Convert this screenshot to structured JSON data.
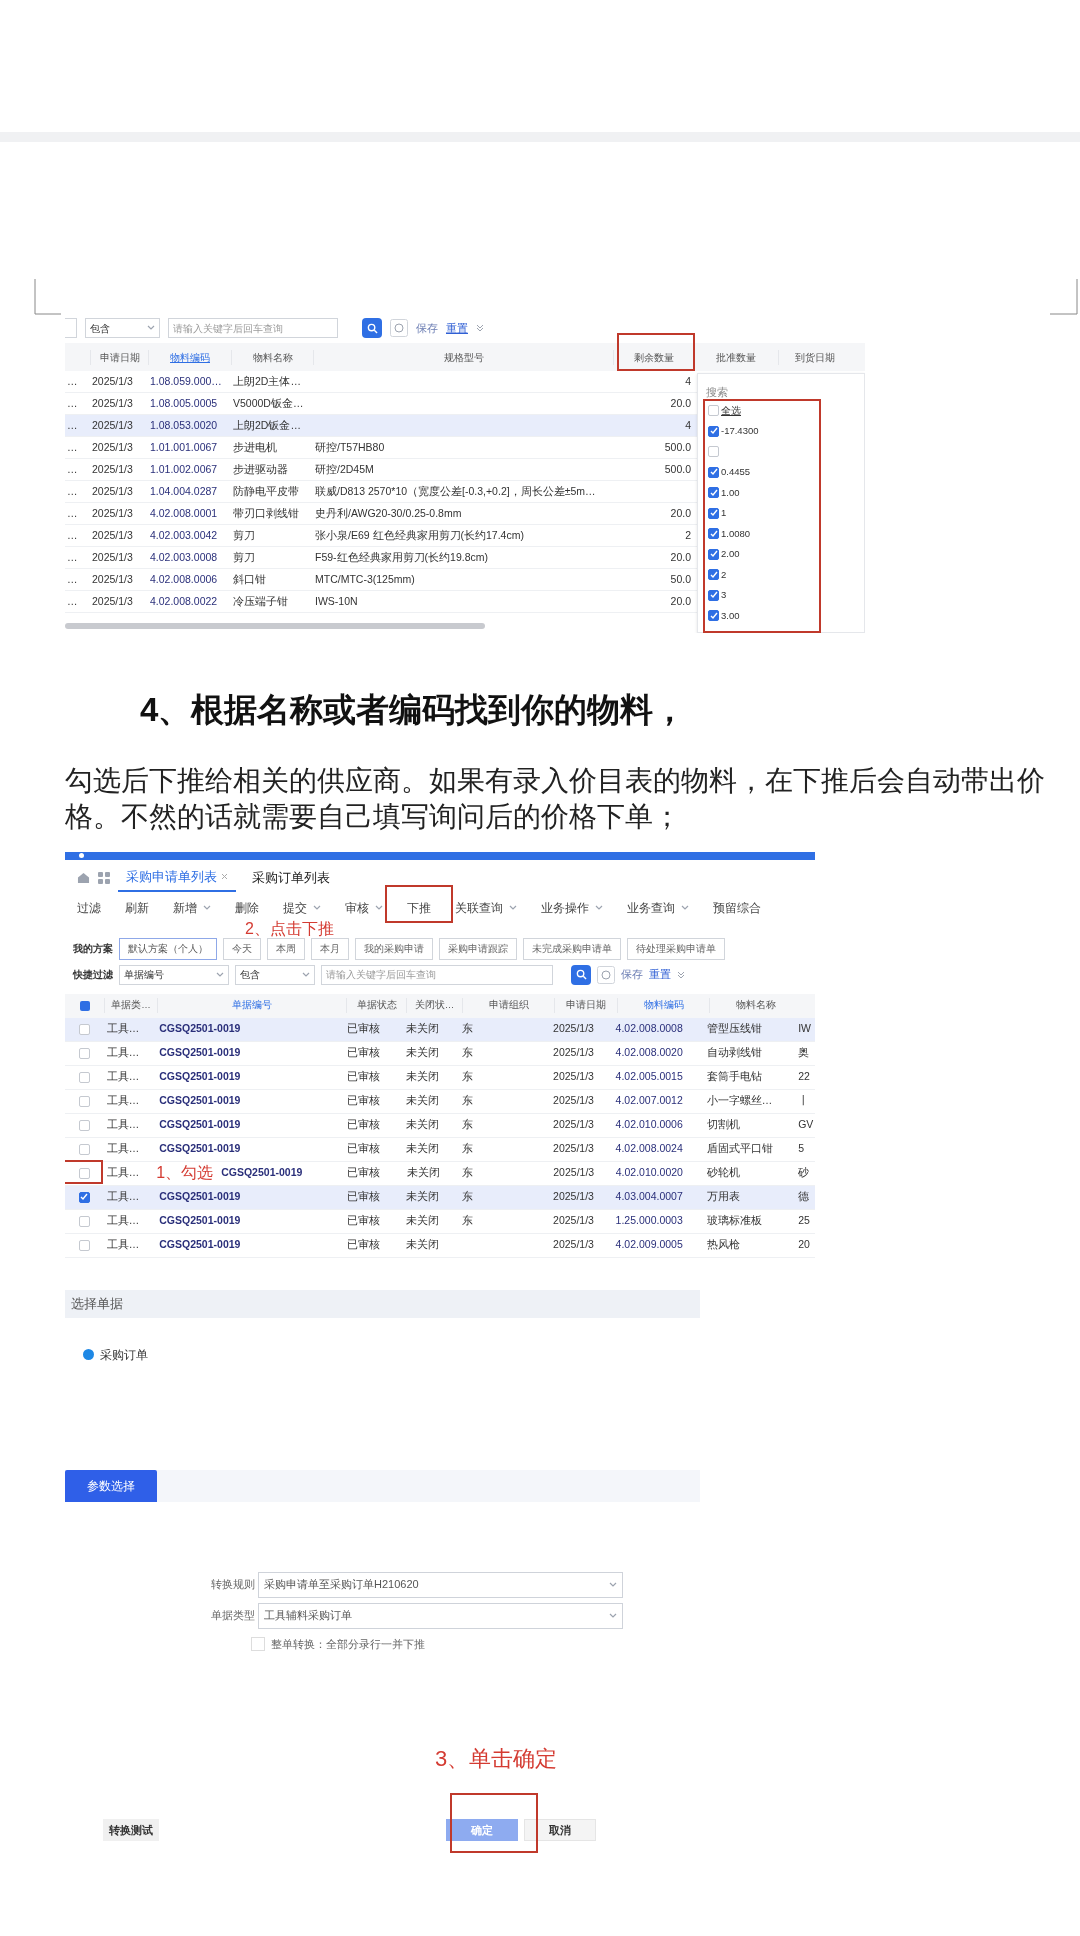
{
  "shot1": {
    "filter_select": "包含",
    "search_placeholder": "请输入关键字后回车查询",
    "save": "保存",
    "reset": "重置",
    "columns": [
      {
        "label": "申请日期",
        "link": false
      },
      {
        "label": "物料编码",
        "link": true
      },
      {
        "label": "物料名称",
        "link": false
      },
      {
        "label": "规格型号",
        "link": false
      },
      {
        "label": "剩余数量",
        "link": false
      },
      {
        "label": "批准数量",
        "link": false
      },
      {
        "label": "到货日期",
        "link": false
      }
    ],
    "rows": [
      {
        "selected": false,
        "lead": "…",
        "cells": [
          "2025/1/3",
          "1.08.059.000…",
          "上朗2D主体…",
          "",
          "4"
        ]
      },
      {
        "selected": false,
        "lead": "…",
        "cells": [
          "2025/1/3",
          "1.08.005.0005",
          "V5000D钣金…",
          "",
          "20.0"
        ]
      },
      {
        "selected": true,
        "lead": "…",
        "cells": [
          "2025/1/3",
          "1.08.053.0020",
          "上朗2D钣金…",
          "",
          "4"
        ]
      },
      {
        "selected": false,
        "lead": "…",
        "cells": [
          "2025/1/3",
          "1.01.001.0067",
          "步进电机",
          "研控/T57HB80",
          "500.0"
        ]
      },
      {
        "selected": false,
        "lead": "…",
        "cells": [
          "2025/1/3",
          "1.01.002.0067",
          "步进驱动器",
          "研控/2D45M",
          "500.0"
        ]
      },
      {
        "selected": false,
        "lead": "…",
        "cells": [
          "2025/1/3",
          "1.04.004.0287",
          "防静电平皮带",
          "联威/D813 2570*10（宽度公差[-0.3,+0.2]，周长公差±5m…",
          ""
        ]
      },
      {
        "selected": false,
        "lead": "…",
        "cells": [
          "2025/1/3",
          "4.02.008.0001",
          "带刃口剥线钳",
          "史丹利/AWG20-30/0.25-0.8mm",
          "20.0"
        ]
      },
      {
        "selected": false,
        "lead": "…",
        "cells": [
          "2025/1/3",
          "4.02.003.0042",
          "剪刀",
          "张小泉/E69 红色经典家用剪刀(长约17.4cm)",
          "2"
        ]
      },
      {
        "selected": false,
        "lead": "…",
        "cells": [
          "2025/1/3",
          "4.02.003.0008",
          "剪刀",
          "F59-红色经典家用剪刀(长约19.8cm)",
          "20.0"
        ]
      },
      {
        "selected": false,
        "lead": "…",
        "cells": [
          "2025/1/3",
          "4.02.008.0006",
          "斜口钳",
          "MTC/MTC-3(125mm)",
          "50.0"
        ]
      },
      {
        "selected": false,
        "lead": "…",
        "cells": [
          "2025/1/3",
          "4.02.008.0022",
          "冷压端子钳",
          "IWS-10N",
          "20.0"
        ]
      }
    ],
    "filter_popup": {
      "title": "搜索",
      "items": [
        {
          "label": "全选",
          "checked": false
        },
        {
          "label": "-17.4300",
          "checked": true
        },
        {
          "checked": false
        },
        {
          "label": "0.4455",
          "checked": true
        },
        {
          "label": "1.00",
          "checked": true
        },
        {
          "label": "1",
          "checked": true
        },
        {
          "label": "1.0080",
          "checked": true
        },
        {
          "label": "2.00",
          "checked": true
        },
        {
          "label": "2",
          "checked": true
        },
        {
          "label": "3",
          "checked": true
        },
        {
          "label": "3.00",
          "checked": true
        }
      ]
    }
  },
  "heading": "4、根据名称或者编码找到你的物料，",
  "paragraph": "勾选后下推给相关的供应商。如果有录入价目表的物料，在下推后会自动带出价格。不然的话就需要自己填写询问后的价格下单；",
  "shot2": {
    "tabs": [
      {
        "label": "采购申请单列表",
        "selected": true,
        "closable": true
      },
      {
        "label": "采购订单列表",
        "selected": false,
        "closable": false
      }
    ],
    "toolbar": [
      {
        "label": "过滤",
        "dropdown": false,
        "highlighted": false
      },
      {
        "label": "刷新",
        "dropdown": false,
        "highlighted": false
      },
      {
        "label": "新增",
        "dropdown": true,
        "highlighted": false
      },
      {
        "label": "删除",
        "dropdown": false,
        "highlighted": false
      },
      {
        "label": "提交",
        "dropdown": true,
        "highlighted": false
      },
      {
        "label": "审核",
        "dropdown": true,
        "highlighted": false
      },
      {
        "label": "下推",
        "dropdown": false,
        "highlighted": true
      },
      {
        "label": "关联查询",
        "dropdown": true,
        "highlighted": false
      },
      {
        "label": "业务操作",
        "dropdown": true,
        "highlighted": false
      },
      {
        "label": "业务查询",
        "dropdown": true,
        "highlighted": false
      },
      {
        "label": "预留综合",
        "dropdown": false,
        "highlighted": false
      }
    ],
    "scheme_label": "我的方案",
    "schemes": [
      {
        "label": "默认方案（个人）",
        "selected": true
      },
      {
        "label": "今天",
        "selected": false
      },
      {
        "label": "本周",
        "selected": false
      },
      {
        "label": "本月",
        "selected": false
      },
      {
        "label": "我的采购申请",
        "selected": false
      },
      {
        "label": "采购申请跟踪",
        "selected": false
      },
      {
        "label": "未完成采购申请单",
        "selected": false
      },
      {
        "label": "待处理采购申请单",
        "selected": false
      }
    ],
    "select_all_checked": true,
    "quick_filter_label": "快捷过滤",
    "field_select": "单据编号",
    "op_select": "包含",
    "search_placeholder": "请输入关键字后回车查询",
    "save": "保存",
    "reset": "重置",
    "columns": [
      {
        "label": "单据类…",
        "link": false
      },
      {
        "label": "单据编号",
        "link": true
      },
      {
        "label": "单据状态",
        "link": false
      },
      {
        "label": "关闭状…",
        "link": false
      },
      {
        "label": "申请组织",
        "link": false
      },
      {
        "label": "申请日期",
        "link": false
      },
      {
        "label": "物料编码",
        "link": true
      },
      {
        "label": "物料名称",
        "link": false
      }
    ],
    "rows": [
      {
        "checked": false,
        "selected": true,
        "cells": [
          "工具…",
          "CGSQ2501-0019",
          "已审核",
          "未关闭",
          "东",
          "2025/1/3",
          "4.02.008.0008",
          "管型压线钳",
          "IW"
        ]
      },
      {
        "checked": false,
        "selected": false,
        "cells": [
          "工具…",
          "CGSQ2501-0019",
          "已审核",
          "未关闭",
          "东",
          "2025/1/3",
          "4.02.008.0020",
          "自动剥线钳",
          "奥"
        ]
      },
      {
        "checked": false,
        "selected": false,
        "cells": [
          "工具…",
          "CGSQ2501-0019",
          "已审核",
          "未关闭",
          "东",
          "2025/1/3",
          "4.02.005.0015",
          "套筒手电钻",
          "22"
        ]
      },
      {
        "checked": false,
        "selected": false,
        "cells": [
          "工具…",
          "CGSQ2501-0019",
          "已审核",
          "未关闭",
          "东",
          "2025/1/3",
          "4.02.007.0012",
          "小一字螺丝…",
          "丨"
        ]
      },
      {
        "checked": false,
        "selected": false,
        "cells": [
          "工具…",
          "CGSQ2501-0019",
          "已审核",
          "未关闭",
          "东",
          "2025/1/3",
          "4.02.010.0006",
          "切割机",
          "GV"
        ]
      },
      {
        "checked": false,
        "selected": false,
        "cells": [
          "工具…",
          "CGSQ2501-0019",
          "已审核",
          "未关闭",
          "东",
          "2025/1/3",
          "4.02.008.0024",
          "盾固式平口钳",
          "5"
        ]
      },
      {
        "checked": false,
        "selected": false,
        "cells": [
          "工具…",
          "CGSQ2501-0019",
          "已审核",
          "未关闭",
          "东",
          "2025/1/3",
          "4.02.010.0020",
          "砂轮机",
          "砂"
        ]
      },
      {
        "checked": true,
        "selected": true,
        "cells": [
          "工具…",
          "CGSQ2501-0019",
          "已审核",
          "未关闭",
          "东",
          "2025/1/3",
          "4.03.004.0007",
          "万用表",
          "德"
        ]
      },
      {
        "checked": false,
        "selected": false,
        "cells": [
          "工具…",
          "CGSQ2501-0019",
          "已审核",
          "未关闭",
          "东",
          "2025/1/3",
          "1.25.000.0003",
          "玻璃标准板",
          "25"
        ]
      },
      {
        "checked": false,
        "selected": false,
        "cells": [
          "工具…",
          "CGSQ2501-0019",
          "已审核",
          "未关闭",
          "",
          "2025/1/3",
          "4.02.009.0005",
          "热风枪",
          "20"
        ]
      }
    ],
    "annotation_push": "2、点击下推",
    "annotation_check": "1、勾选"
  },
  "dialog": {
    "section1": "选择单据",
    "options": [
      {
        "label": "采购订单",
        "selected": true
      }
    ],
    "section2": "参数选择",
    "fields": [
      {
        "label": "转换规则",
        "value": "采购申请单至采购订单H210620"
      },
      {
        "label": "单据类型",
        "value": "工具辅料采购订单"
      }
    ],
    "whole_convert": {
      "label": "整单转换：全部分录行一并下推",
      "checked": false
    },
    "annotation_confirm": "3、单击确定",
    "test_button": "转换测试",
    "ok_button": "确定",
    "cancel_button": "取消"
  }
}
